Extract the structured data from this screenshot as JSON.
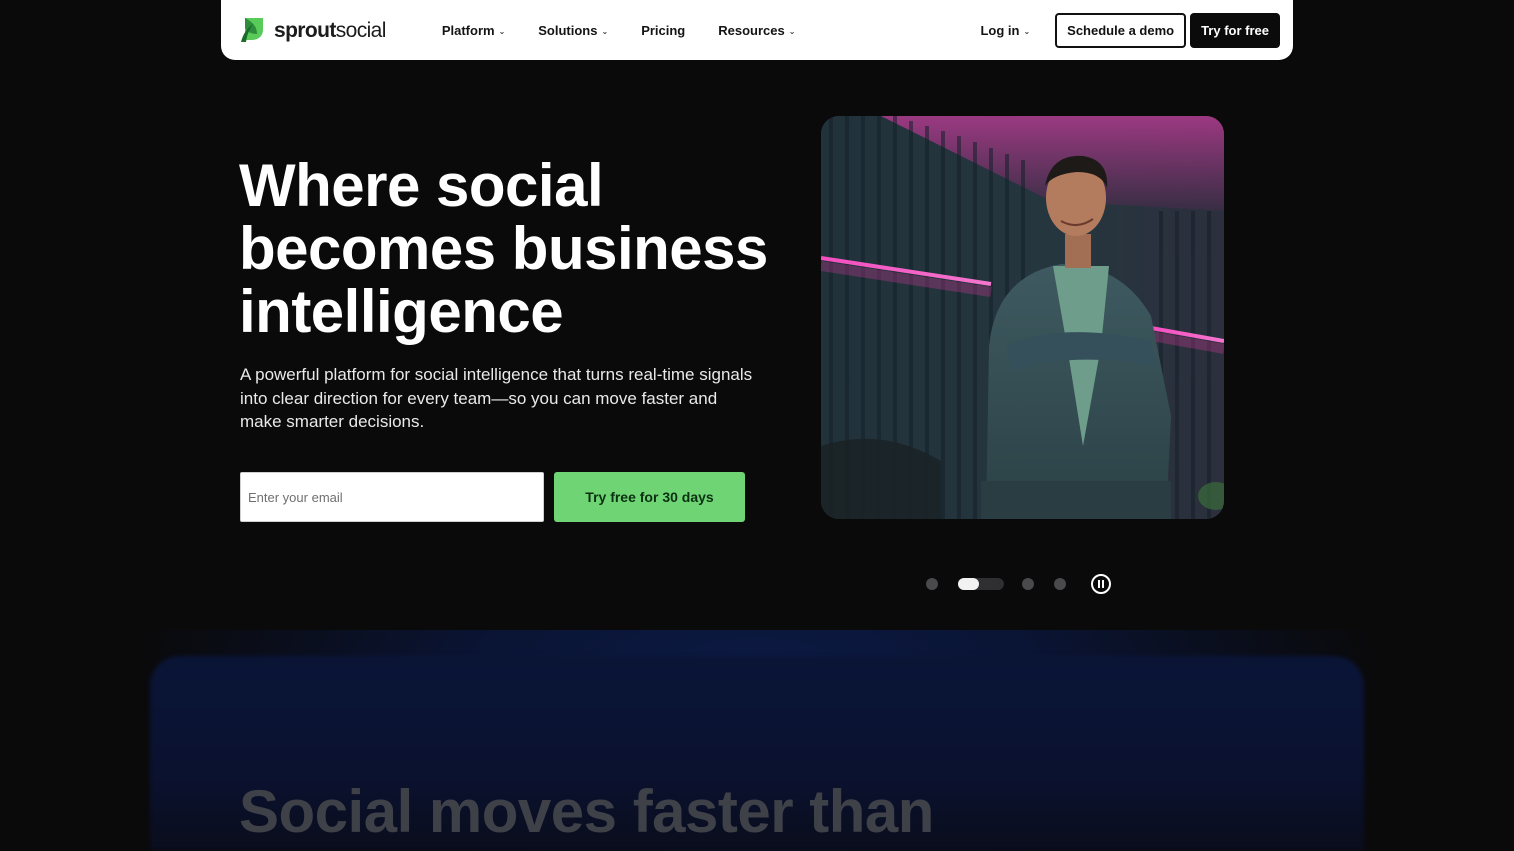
{
  "brand": {
    "name_bold": "sprout",
    "name_regular": "social",
    "accent": "#6fd574"
  },
  "nav": {
    "items": [
      {
        "label": "Platform",
        "has_menu": true
      },
      {
        "label": "Solutions",
        "has_menu": true
      },
      {
        "label": "Pricing",
        "has_menu": false
      },
      {
        "label": "Resources",
        "has_menu": true
      }
    ],
    "login_label": "Log in",
    "demo_label": "Schedule a demo",
    "try_label": "Try for free",
    "chevron": "⌄"
  },
  "hero": {
    "title_line1": "Where social",
    "title_line2": "becomes business",
    "title_line3": "intelligence",
    "subtitle": "A powerful platform for social intelligence that turns real-time signals into clear direction for every team—so you can move faster and make smarter decisions.",
    "email_placeholder": "Enter your email",
    "email_value": "",
    "cta_label": "Try free for 30 days"
  },
  "carousel": {
    "slide_count": 4,
    "active_index": 1,
    "active_progress": 0.45,
    "paused": false
  },
  "lower": {
    "title": "Social moves faster than"
  },
  "icons": {
    "logo": "sprout-leaf-icon",
    "pause": "pause-icon",
    "chevron": "chevron-down-icon"
  },
  "colors": {
    "background": "#0a0a0b",
    "cta_green": "#6fd574",
    "nav_bg": "#ffffff"
  }
}
